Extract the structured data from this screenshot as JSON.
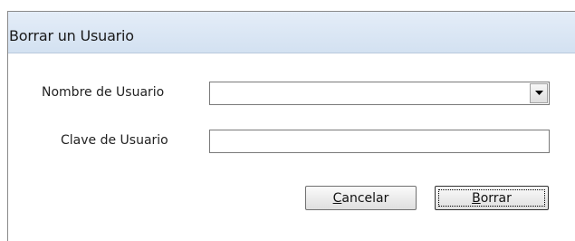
{
  "window": {
    "title": "Borrar un Usuario"
  },
  "form": {
    "username_label": "Nombre de Usuario",
    "username_value": "",
    "password_label": "Clave de Usuario",
    "password_value": ""
  },
  "buttons": {
    "cancel": {
      "accel": "C",
      "rest": "ancelar"
    },
    "delete": {
      "accel": "B",
      "rest": "orrar"
    }
  },
  "icons": {
    "dropdown": "chevron-down-icon"
  },
  "colors": {
    "title_bar": "#d8e4f3",
    "border": "#7a7a7a"
  }
}
